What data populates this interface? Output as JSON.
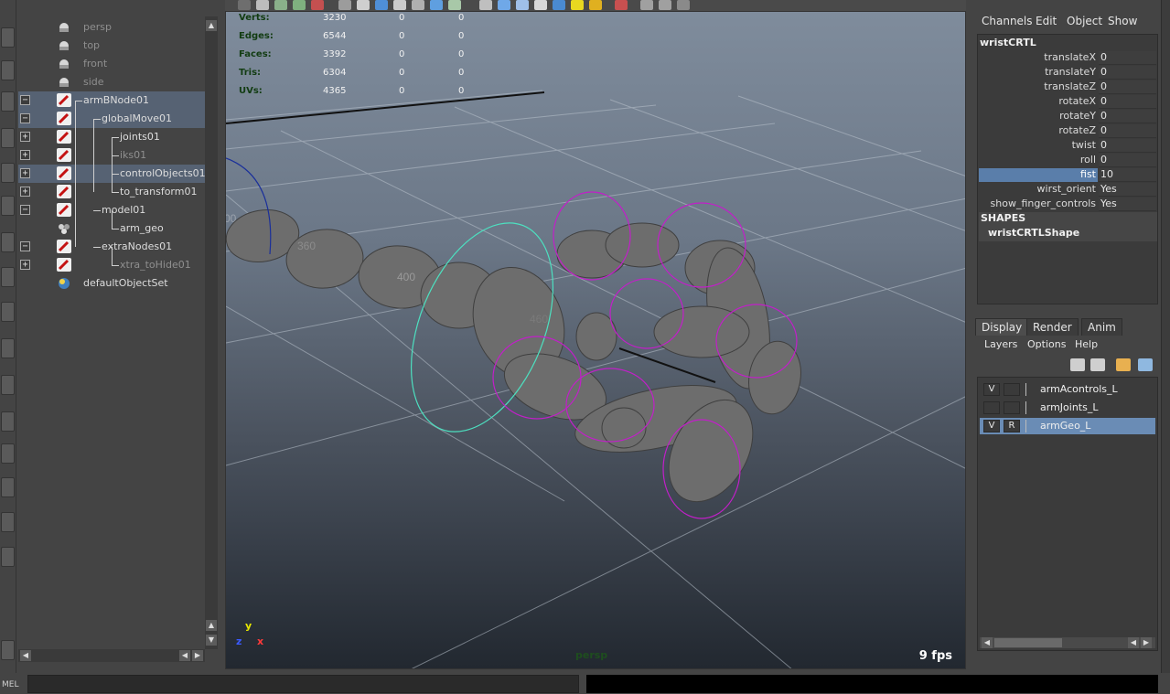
{
  "outliner": {
    "items": [
      {
        "label": "persp",
        "dim": true
      },
      {
        "label": "top",
        "dim": true
      },
      {
        "label": "front",
        "dim": true
      },
      {
        "label": "side",
        "dim": true
      },
      {
        "label": "armBNode01",
        "expander": "−"
      },
      {
        "label": "globalMove01",
        "expander": "−"
      },
      {
        "label": "joints01",
        "expander": "+"
      },
      {
        "label": "iks01",
        "expander": "+",
        "dim": true
      },
      {
        "label": "controlObjects01",
        "expander": "+"
      },
      {
        "label": "to_transform01",
        "expander": "+"
      },
      {
        "label": "model01",
        "expander": "−"
      },
      {
        "label": "arm_geo"
      },
      {
        "label": "extraNodes01",
        "expander": "−"
      },
      {
        "label": "xtra_toHide01",
        "expander": "+",
        "dim": true
      },
      {
        "label": "defaultObjectSet"
      }
    ]
  },
  "viewport": {
    "hud": [
      {
        "label": "Verts:",
        "v1": "3230",
        "v2": "0",
        "v3": "0"
      },
      {
        "label": "Edges:",
        "v1": "6544",
        "v2": "0",
        "v3": "0"
      },
      {
        "label": "Faces:",
        "v1": "3392",
        "v2": "0",
        "v3": "0"
      },
      {
        "label": "Tris:",
        "v1": "6304",
        "v2": "0",
        "v3": "0"
      },
      {
        "label": "UVs:",
        "v1": "4365",
        "v2": "0",
        "v3": "0"
      }
    ],
    "camera_name": "persp",
    "fps": "9 fps",
    "axis": {
      "x": "x",
      "y": "y",
      "z": "z"
    },
    "grid_labels": [
      "360",
      "400",
      "460"
    ]
  },
  "channel_box": {
    "menus": [
      "Channels",
      "Edit",
      "Object",
      "Show"
    ],
    "object_name": "wristCRTL",
    "channels": [
      {
        "name": "translateX",
        "value": "0"
      },
      {
        "name": "translateY",
        "value": "0"
      },
      {
        "name": "translateZ",
        "value": "0"
      },
      {
        "name": "rotateX",
        "value": "0"
      },
      {
        "name": "rotateY",
        "value": "0"
      },
      {
        "name": "rotateZ",
        "value": "0"
      },
      {
        "name": "twist",
        "value": "0"
      },
      {
        "name": "roll",
        "value": "0"
      },
      {
        "name": "fist",
        "value": "10",
        "selected": true
      },
      {
        "name": "wirst_orient",
        "value": "Yes"
      },
      {
        "name": "show_finger_controls",
        "value": "Yes"
      }
    ],
    "shapes_header": "SHAPES",
    "shape_name": "wristCRTLShape"
  },
  "layer_editor": {
    "tabs": [
      "Display",
      "Render",
      "Anim"
    ],
    "menus": [
      "Layers",
      "Options",
      "Help"
    ],
    "layers": [
      {
        "v": "V",
        "r": "",
        "name": "armAcontrols_L"
      },
      {
        "v": "",
        "r": "",
        "name": "armJoints_L"
      },
      {
        "v": "V",
        "r": "R",
        "name": "armGeo_L",
        "selected": true
      }
    ]
  },
  "command_line": {
    "label": "MEL"
  },
  "colors": {
    "selection": "#566273",
    "channel_selected": "#5a7eaa",
    "controls_magenta": "#c21fc9",
    "controls_cyan": "#4de0c0",
    "hud_label": "#123c12"
  }
}
